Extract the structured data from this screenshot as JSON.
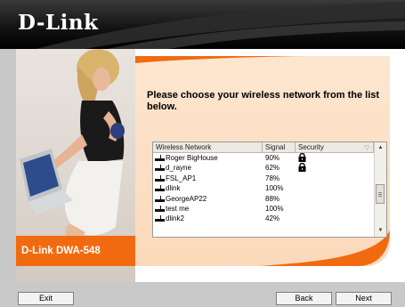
{
  "brand": {
    "logo": "D-Link"
  },
  "model_label": "D-Link DWA-548",
  "prompt": "Please choose your wireless network from the list below.",
  "network_list": {
    "columns": {
      "network": "Wireless Network",
      "signal": "Signal",
      "security": "Security"
    },
    "rows": [
      {
        "name": "Roger BigHouse",
        "signal": "90%",
        "secured": true
      },
      {
        "name": "d_rayne",
        "signal": "62%",
        "secured": true
      },
      {
        "name": "FSL_AP1",
        "signal": "78%",
        "secured": false
      },
      {
        "name": "dlink",
        "signal": "100%",
        "secured": false
      },
      {
        "name": "GeorgeAP22",
        "signal": "88%",
        "secured": false
      },
      {
        "name": "test me",
        "signal": "100%",
        "secured": false
      },
      {
        "name": "dlink2",
        "signal": "42%",
        "secured": false
      }
    ]
  },
  "buttons": {
    "exit": "Exit",
    "back": "Back",
    "next": "Next"
  },
  "icons": {
    "network": "wireless-network-icon",
    "lock": "lock-icon",
    "scroll_up": "scroll-up-arrow-icon",
    "scroll_down": "scroll-down-arrow-icon",
    "sort": "sort-arrow-icon"
  },
  "colors": {
    "accent": "#f26a10",
    "panel": "#fbdcc0",
    "header": "#111111",
    "frame": "#c9c9c9"
  }
}
